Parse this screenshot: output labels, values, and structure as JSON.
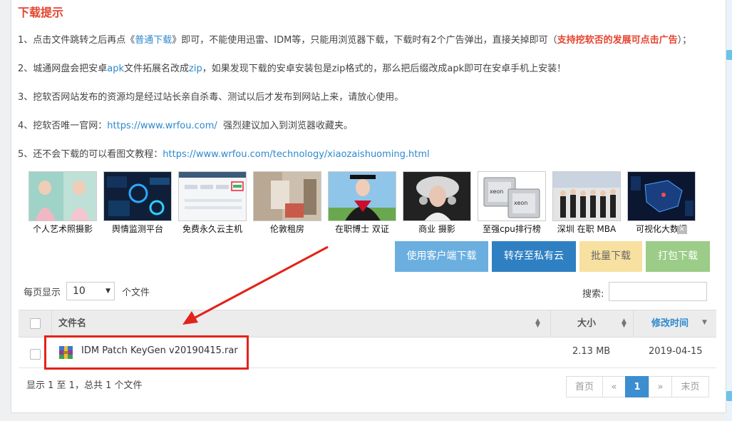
{
  "title": "下载提示",
  "tips": {
    "t1_a": "1、点击文件跳转之后再点《",
    "t1_link": "普通下载",
    "t1_b": "》即可，不能使用迅雷、IDM等，只能用浏览器下载，下载时有2个广告弹出，直接关掉即可（",
    "t1_red": "支持挖软否的发展可点击广告",
    "t1_c": "）；",
    "t2_a": "2、城通网盘会把安卓",
    "t2_apk": "apk",
    "t2_b": "文件拓展名改成",
    "t2_zip": "zip",
    "t2_c": "，如果发现下载的安卓安装包是zip格式的，那么把后缀改成apk即可在安卓手机上安装！",
    "t3": "3、挖软否网站发布的资源均是经过站长亲自杀毒、测试以后才发布到网站上来，请放心使用。",
    "t4_a": "4、挖软否唯一官网：",
    "t4_link": "https://www.wrfou.com/",
    "t4_b": "强烈建议加入到浏览器收藏夹。",
    "t5_a": "5、还不会下载的可以看图文教程：",
    "t5_link": "https://www.wrfou.com/technology/xiaozaishuoming.html"
  },
  "ads": [
    {
      "caption": "个人艺术照摄影"
    },
    {
      "caption": "舆情监测平台"
    },
    {
      "caption": "免费永久云主机"
    },
    {
      "caption": "伦敦租房"
    },
    {
      "caption": "在职博士 双证"
    },
    {
      "caption": "商业 摄影"
    },
    {
      "caption": "至强cpu排行榜"
    },
    {
      "caption": "深圳 在职 MBA"
    },
    {
      "caption": "可视化大数据"
    }
  ],
  "ad_close": "✕",
  "buttons": {
    "client": "使用客户端下载",
    "save": "转存至私有云",
    "batch": "批量下载",
    "pack": "打包下载"
  },
  "perpage_label": "每页显示",
  "perpage_value": "10",
  "files_label": "个文件",
  "search_label": "搜索:",
  "table": {
    "col_name": "文件名",
    "col_size": "大小",
    "col_date": "修改时间",
    "rows": [
      {
        "name": "IDM Patch KeyGen v20190415.rar",
        "size": "2.13 MB",
        "date": "2019-04-15"
      }
    ]
  },
  "summary": "显示 1 至 1，总共 1 个文件",
  "pager": {
    "first": "首页",
    "prev": "«",
    "current": "1",
    "next": "»",
    "last": "末页"
  },
  "colors": {
    "accent_red": "#e5442f",
    "link_blue": "#2d89cc",
    "highlight": "#e2231a"
  }
}
